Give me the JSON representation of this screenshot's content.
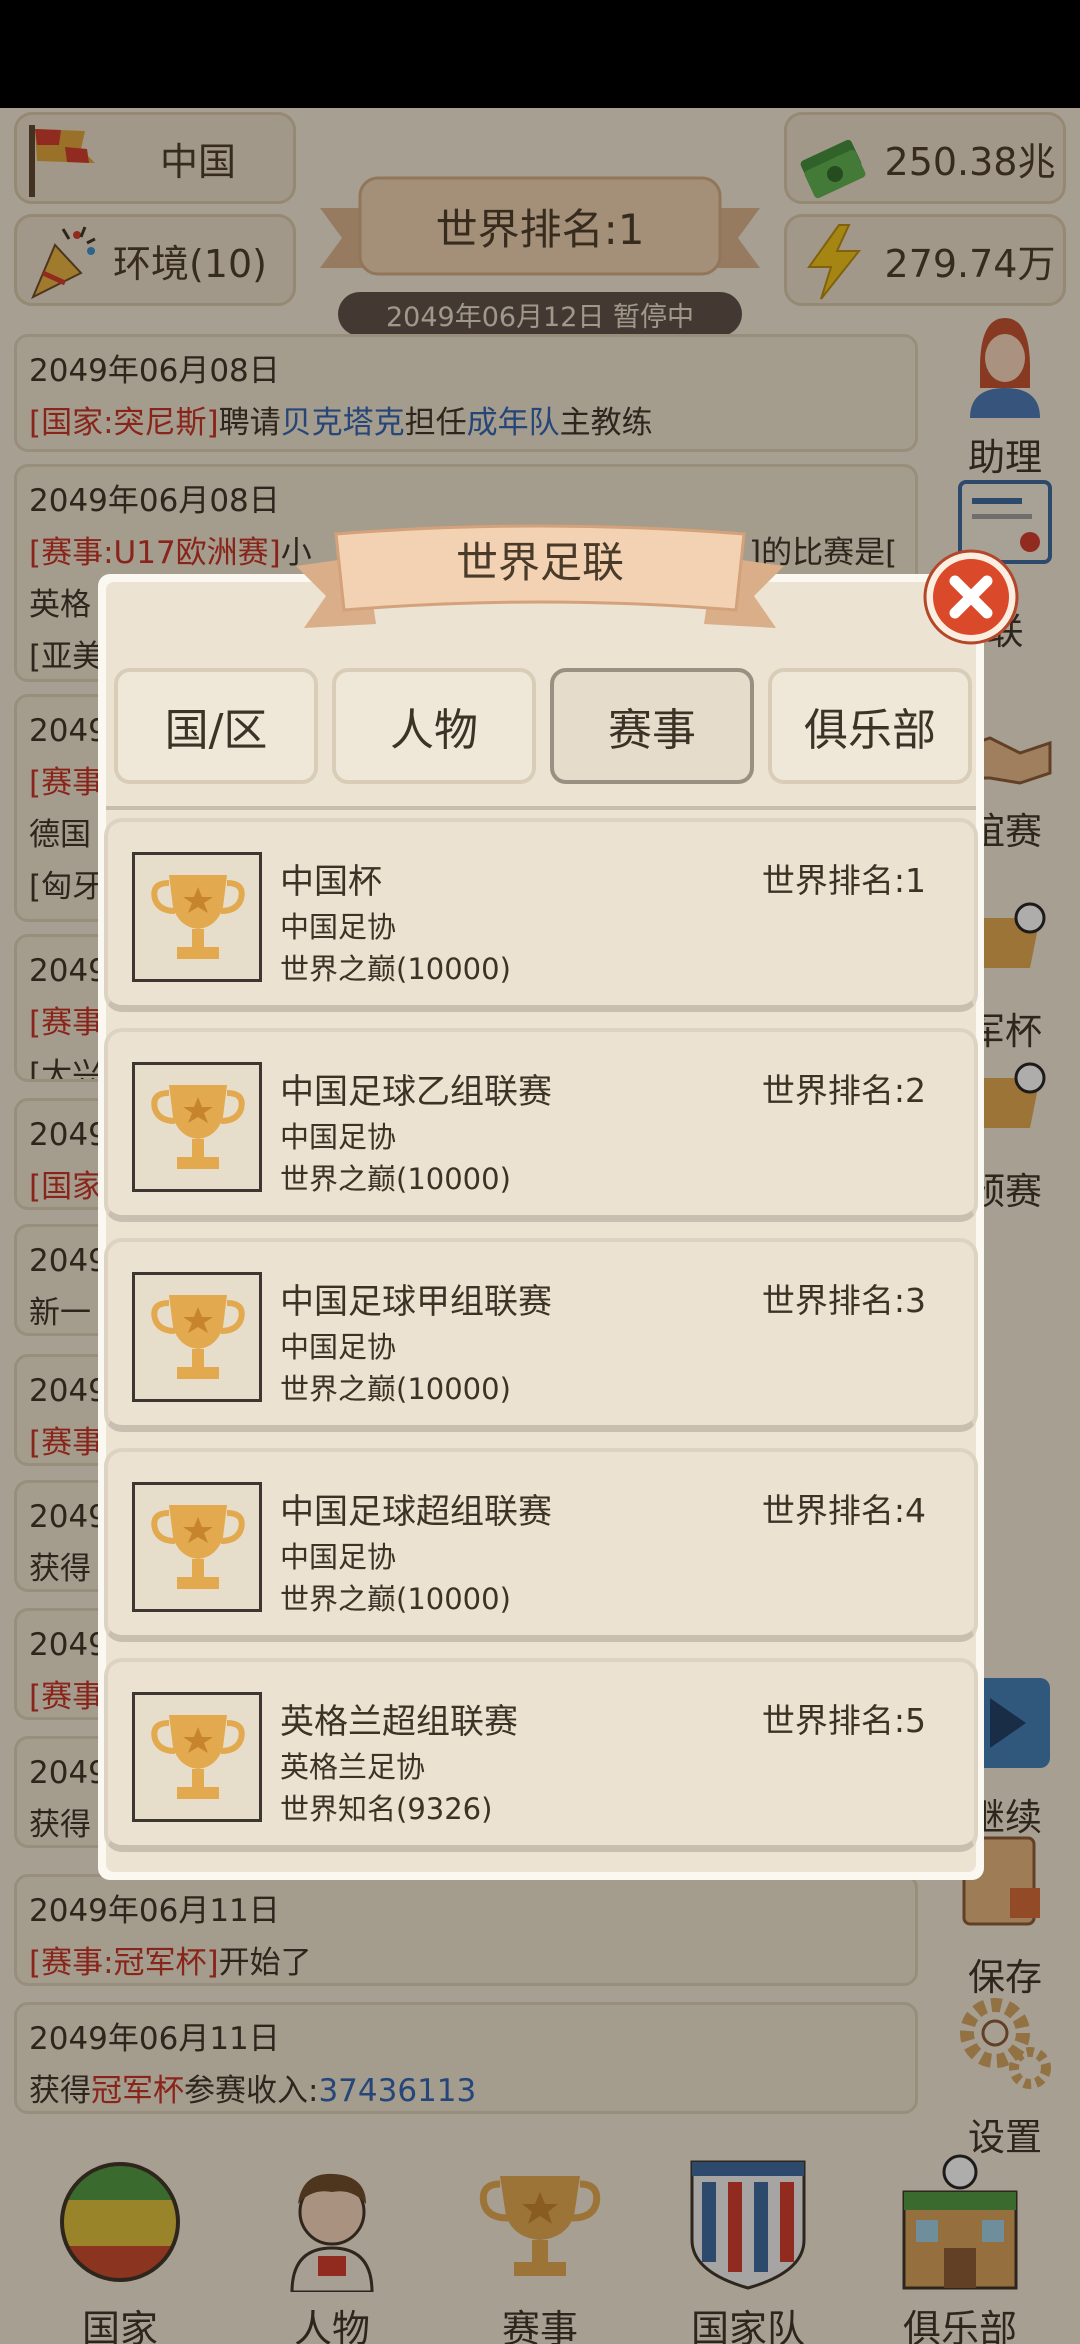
{
  "top": {
    "country": "中国",
    "environment": "环境(10)",
    "money": "250.38兆",
    "energy": "279.74万",
    "world_rank": "世界排名:1",
    "date_status": "2049年06月12日 暂停中"
  },
  "logs": [
    {
      "date": "2049年06月08日",
      "parts": [
        {
          "t": "[国家:突尼斯]",
          "c": "red"
        },
        {
          "t": "聘请",
          "c": ""
        },
        {
          "t": "贝克塔克",
          "c": "blue"
        },
        {
          "t": "担任",
          "c": ""
        },
        {
          "t": "成年队",
          "c": "blue"
        },
        {
          "t": "主教练",
          "c": ""
        }
      ]
    },
    {
      "date": "2049年06月08日",
      "parts": [
        {
          "t": "[赛事:U17欧洲赛]",
          "c": "red"
        },
        {
          "t": "小",
          "c": ""
        }
      ],
      "extra": [
        "英格",
        "[亚美"
      ],
      "tail": "]的比赛是["
    },
    {
      "date": "2049",
      "parts": [
        {
          "t": "[赛事",
          "c": "red"
        }
      ],
      "extra": [
        "德国",
        "[匈牙"
      ]
    },
    {
      "date": "2049",
      "parts": [
        {
          "t": "[赛事",
          "c": "red"
        }
      ],
      "extra": [
        "[大兴"
      ]
    },
    {
      "date": "2049",
      "parts": [
        {
          "t": "[国家",
          "c": "red"
        }
      ]
    },
    {
      "date": "2049",
      "parts": [
        {
          "t": "新一",
          "c": ""
        }
      ]
    },
    {
      "date": "2049",
      "parts": [
        {
          "t": "[赛事",
          "c": "red"
        }
      ]
    },
    {
      "date": "2049",
      "parts": [
        {
          "t": "获得",
          "c": ""
        }
      ]
    },
    {
      "date": "2049",
      "parts": [
        {
          "t": "[赛事",
          "c": "red"
        }
      ]
    },
    {
      "date": "2049",
      "parts": [
        {
          "t": "获得",
          "c": ""
        }
      ]
    },
    {
      "date": "2049年06月11日",
      "parts": [
        {
          "t": "[赛事:冠军杯]",
          "c": "red"
        },
        {
          "t": "开始了",
          "c": ""
        }
      ]
    },
    {
      "date": "2049年06月11日",
      "parts": [
        {
          "t": "获得",
          "c": ""
        },
        {
          "t": "冠军杯",
          "c": "red"
        },
        {
          "t": "参赛收入:",
          "c": ""
        },
        {
          "t": "37436113",
          "c": "blue"
        }
      ]
    }
  ],
  "side": {
    "assistant": "助理",
    "league": "联",
    "friendly": "谊赛",
    "champions": "军杯",
    "qualifier": "预赛",
    "continue": "继续",
    "save": "保存",
    "settings": "设置"
  },
  "nav": [
    "国家",
    "人物",
    "赛事",
    "国家队",
    "俱乐部"
  ],
  "modal": {
    "title": "世界足联",
    "tabs": [
      "国/区",
      "人物",
      "赛事",
      "俱乐部"
    ],
    "active_tab": 2,
    "competitions": [
      {
        "name": "中国杯",
        "assoc": "中国足协",
        "level": "世界之巅(10000)",
        "rank": "世界排名:1"
      },
      {
        "name": "中国足球乙组联赛",
        "assoc": "中国足协",
        "level": "世界之巅(10000)",
        "rank": "世界排名:2"
      },
      {
        "name": "中国足球甲组联赛",
        "assoc": "中国足协",
        "level": "世界之巅(10000)",
        "rank": "世界排名:3"
      },
      {
        "name": "中国足球超组联赛",
        "assoc": "中国足协",
        "level": "世界之巅(10000)",
        "rank": "世界排名:4"
      },
      {
        "name": "英格兰超组联赛",
        "assoc": "英格兰足协",
        "level": "世界知名(9326)",
        "rank": "世界排名:5"
      }
    ]
  },
  "colors": {
    "accent_red": "#c53025",
    "accent_blue": "#2f63b4",
    "panel": "#ece3d2",
    "close": "#d9492a"
  }
}
